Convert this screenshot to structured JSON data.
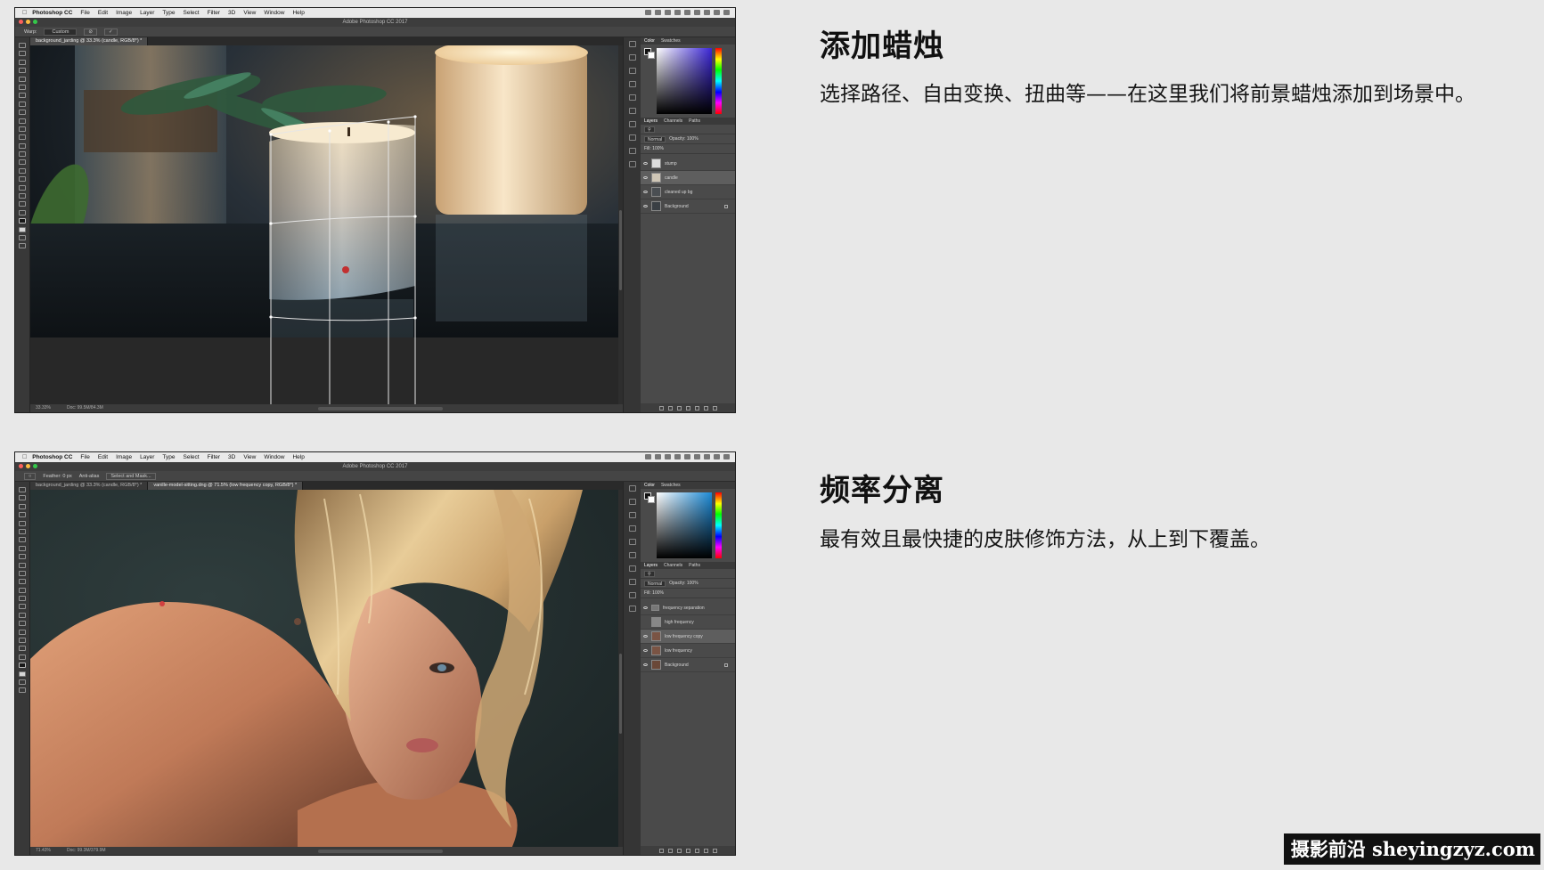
{
  "mac_menu": {
    "app": "Photoshop CC",
    "items": [
      "File",
      "Edit",
      "Image",
      "Layer",
      "Type",
      "Select",
      "Filter",
      "3D",
      "View",
      "Window",
      "Help"
    ]
  },
  "windows": [
    {
      "window_title": "Adobe Photoshop CC 2017",
      "options": [
        "Warp:",
        "Custom"
      ],
      "tabs": [
        {
          "label": "background_jarding @ 33.3% (candle, RGB/8*) *",
          "active": true
        }
      ],
      "status": [
        "33.33%",
        "Doc: 99.5M/84.3M"
      ],
      "panel_tabs_top": [
        "Color",
        "Swatches"
      ],
      "panel_tabs_layers": [
        "Layers",
        "Channels",
        "Paths"
      ],
      "blend_mode": "Normal",
      "opacity_label": "Opacity: 100%",
      "fill_label": "Fill: 100%",
      "layers": [
        {
          "name": "stump",
          "selected": false,
          "lock": false
        },
        {
          "name": "candle",
          "selected": true,
          "lock": false
        },
        {
          "name": "cleaned up bg",
          "selected": false,
          "lock": false
        },
        {
          "name": "Background",
          "selected": false,
          "lock": true
        }
      ]
    },
    {
      "window_title": "Adobe Photoshop CC 2017",
      "options": [
        "Feather: 0 px",
        "Anti-alias",
        "Select and Mask..."
      ],
      "tabs": [
        {
          "label": "background_jarding @ 33.3% (candle, RGB/8*) *",
          "active": false
        },
        {
          "label": "vanille-model-sitting.dng @ 71.5% (low frequency copy, RGB/8*) *",
          "active": true
        }
      ],
      "status": [
        "71.43%",
        "Doc: 99.3M/379.9M"
      ],
      "panel_tabs_top": [
        "Color",
        "Swatches"
      ],
      "panel_tabs_layers": [
        "Layers",
        "Channels",
        "Paths"
      ],
      "blend_mode": "Normal",
      "opacity_label": "Opacity: 100%",
      "fill_label": "Fill: 100%",
      "layers": [
        {
          "name": "frequency separation",
          "selected": false,
          "lock": false
        },
        {
          "name": "high frequency",
          "selected": false,
          "lock": false
        },
        {
          "name": "low frequency copy",
          "selected": true,
          "lock": false
        },
        {
          "name": "low frequency",
          "selected": false,
          "lock": false
        },
        {
          "name": "Background",
          "selected": false,
          "lock": true
        }
      ]
    }
  ],
  "sections": [
    {
      "heading": "添加蜡烛",
      "description": "选择路径、自由变换、扭曲等——在这里我们将前景蜡烛添加到场景中。"
    },
    {
      "heading": "频率分离",
      "description": "最有效且最快捷的皮肤修饰方法，从上到下覆盖。"
    }
  ],
  "watermark": "摄影前沿 sheyingzyz.com",
  "colors": {
    "page_bg": "#e8e8e8",
    "ps_chrome": "#323232",
    "panel_bg": "#4a4a4a",
    "selected_layer": "#5e5e5e"
  }
}
